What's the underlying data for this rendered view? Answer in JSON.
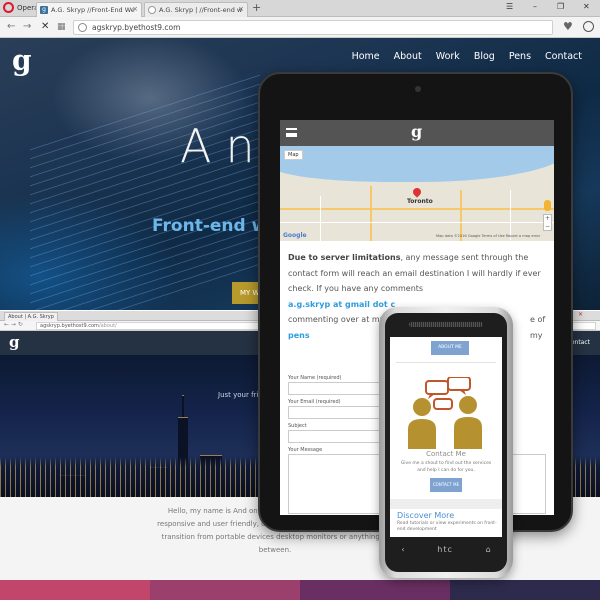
{
  "browser": {
    "brand": "Opera",
    "tabs": [
      {
        "label": "A.G. Skryp //Front-End We"
      },
      {
        "label": "A.G. Skryp | //Front-end w"
      }
    ],
    "url": "agskryp.byethost9.com"
  },
  "site": {
    "logo": "g",
    "nav": [
      "Home",
      "About",
      "Work",
      "Blog",
      "Pens",
      "Contact"
    ],
    "hero_title": "An Skry",
    "hero_subtitle": "Front-end w",
    "hero_button": "MY W"
  },
  "second_browser": {
    "tab_label": "About | A.G. Skryp",
    "url_host": "agskryp.byethost9.com",
    "url_path": "/about/",
    "logo": "g",
    "nav_contact": "Contact",
    "hero_text": "Just your fri",
    "paragraph": "Hello, my name is And on programming the fr pages that are responsive and user friendly, creating desig simple, sharp, and can transition from portable devices desktop monitors or anything in between.",
    "tile_colors": [
      "#c2456b",
      "#9b3f6c",
      "#6a2f62",
      "#2d2a4d"
    ]
  },
  "tablet": {
    "logo": "g",
    "map": {
      "tab_label": "Map",
      "city": "Toronto",
      "footer": "Map data ©2016 Google   Terms of Use   Report a map error",
      "google": "Google"
    },
    "notice_bold": "Due to server limitations",
    "notice_1": ", any message sent through the contact form will reach an email destination I will hardly if ever check. If you have any comments",
    "email_link": "a.g.skryp at gmail dot c",
    "notice_2": "commenting over at my",
    "notice_3": "e of my",
    "pens_link": "pens",
    "form": {
      "name_label": "Your Name (required)",
      "email_label": "Your Email (required)",
      "subject_label": "Subject",
      "message_label": "Your Message"
    }
  },
  "phone": {
    "about_btn": "ABOUT ME",
    "contact_title": "Contact Me",
    "contact_desc": "Give me a shout to find out the services and help I can do for you.",
    "contact_btn": "CONTACT ME",
    "discover_title": "Discover More",
    "discover_desc": "Read tutorials or view experiments on front-end development",
    "brand": "htc"
  }
}
